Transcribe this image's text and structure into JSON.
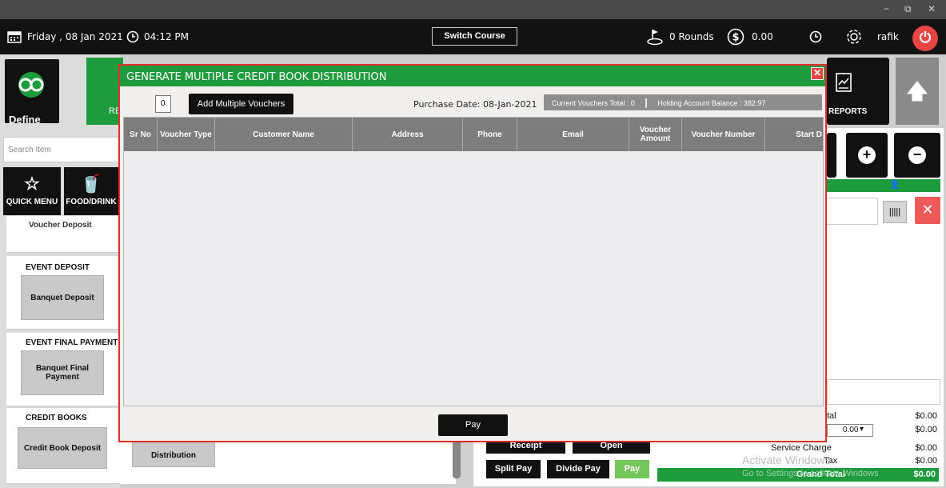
{
  "window": {
    "minimize": "−",
    "restore": "⧉",
    "close": "✕"
  },
  "topbar": {
    "date": "Friday , 08 Jan 2021",
    "time": "04:12 PM",
    "switch_course": "Switch Course",
    "rounds": "0 Rounds",
    "amount": "0.00",
    "user": "rafik"
  },
  "left": {
    "define": "Define",
    "tile_partial": "RE",
    "search_placeholder": "Search Item",
    "quick_menu": "QUICK MENU",
    "food_drink": "FOOD/DRINK",
    "voucher_deposit_cut": "Voucher Deposit",
    "event_deposit": "EVENT DEPOSIT",
    "banquet_deposit": "Banquet Deposit",
    "event_final_payment": "EVENT FINAL PAYMENT",
    "banquet_final_payment": "Banquet Final Payment",
    "credit_books": "CREDIT BOOKS",
    "credit_book_deposit": "Credit Book Deposit",
    "distribution": "Distribution"
  },
  "right": {
    "reports": "REPORTS",
    "total_label": "tal",
    "total_value": "$0.00",
    "discount_value": "0.00",
    "discount_amount": "$0.00",
    "service_charge": "Service Charge",
    "service_charge_value": "$0.00",
    "tax": "Tax",
    "tax_value": "$0.00",
    "grand_total": "Grand Total",
    "grand_total_value": "$0.00",
    "activate1": "Activate Windows",
    "activate2": "Go to Settings to activate Windows.",
    "receipt": "Receipt",
    "open": "Open",
    "split_pay": "Split Pay",
    "divide_pay": "Divide Pay",
    "pay": "Pay"
  },
  "modal": {
    "title": "GENERATE MULTIPLE CREDIT BOOK DISTRIBUTION",
    "quantity": "0",
    "add_button": "Add Multiple Vouchers",
    "purchase_date": "Purchase Date: 08-Jan-2021",
    "current_total": "Current Vouchers Total : 0",
    "separator": "|",
    "holding_balance": "Holding Account Balance : 382.97",
    "columns": [
      "Sr No",
      "Voucher Type",
      "Customer Name",
      "Address",
      "Phone",
      "Email",
      "Voucher Amount",
      "Voucher Number",
      "Start D"
    ],
    "pay": "Pay"
  },
  "colors": {
    "accent_green": "#1e9b3c",
    "alert_red": "#e22d2d",
    "dark": "#111111"
  }
}
